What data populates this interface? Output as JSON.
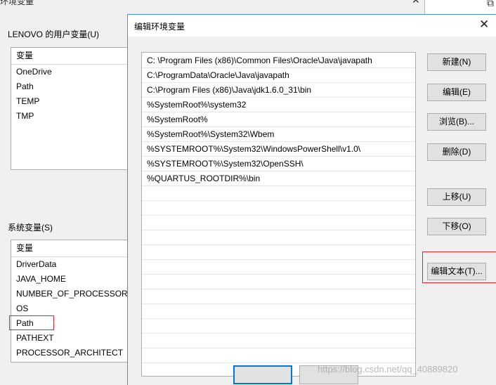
{
  "background_window": {
    "title": "环境变量",
    "user_group_label": "LENOVO 的用户变量(U)",
    "user_vars_header": "变量",
    "user_vars": [
      "OneDrive",
      "Path",
      "TEMP",
      "TMP"
    ],
    "system_group_label": "系统变量(S)",
    "system_vars_header": "变量",
    "system_vars": [
      "DriverData",
      "JAVA_HOME",
      "NUMBER_OF_PROCESSORS",
      "OS",
      "Path",
      "PATHEXT",
      "PROCESSOR_ARCHITECT"
    ]
  },
  "dialog": {
    "title": "编辑环境变量",
    "paths": [
      "C: \\Program Files (x86)\\Common Files\\Oracle\\Java\\javapath",
      "C:\\ProgramData\\Oracle\\Java\\javapath",
      "C:\\Program Files (x86)\\Java\\jdk1.6.0_31\\bin",
      "%SystemRoot%\\system32",
      "%SystemRoot%",
      "%SystemRoot%\\System32\\Wbem",
      "%SYSTEMROOT%\\System32\\WindowsPowerShell\\v1.0\\",
      "%SYSTEMROOT%\\System32\\OpenSSH\\",
      "%QUARTUS_ROOTDIR%\\bin"
    ],
    "buttons": {
      "new": "新建(N)",
      "edit": "编辑(E)",
      "browse": "浏览(B)...",
      "delete": "删除(D)",
      "move_up": "上移(U)",
      "move_down": "下移(O)",
      "edit_text": "编辑文本(T)..."
    }
  },
  "watermark": "https://blog.csdn.net/qq_40889820",
  "colors": {
    "highlight": "#e1252a",
    "accent": "#0078d7"
  }
}
